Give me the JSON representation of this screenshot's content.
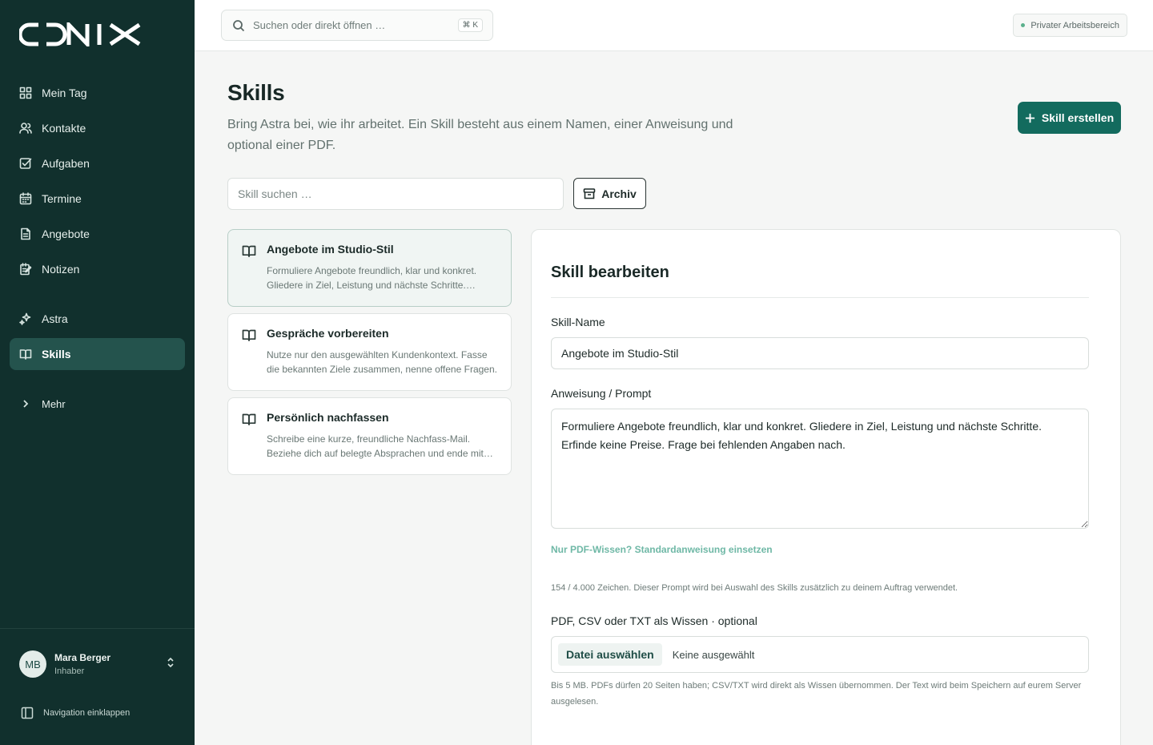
{
  "brand": {
    "logo": "CONIX"
  },
  "sidebar": {
    "items": [
      {
        "label": "Mein Tag",
        "icon": "dashboard-icon"
      },
      {
        "label": "Kontakte",
        "icon": "contacts-icon"
      },
      {
        "label": "Aufgaben",
        "icon": "tasks-icon"
      },
      {
        "label": "Termine",
        "icon": "calendar-icon"
      },
      {
        "label": "Angebote",
        "icon": "offers-icon"
      },
      {
        "label": "Notizen",
        "icon": "notes-icon"
      }
    ],
    "items2": [
      {
        "label": "Astra",
        "icon": "sparkles-icon"
      },
      {
        "label": "Skills",
        "icon": "book-icon",
        "active": true
      }
    ],
    "more": "Mehr",
    "user": {
      "initials": "MB",
      "name": "Mara Berger",
      "role": "Inhaber"
    },
    "collapse": "Navigation einklappen"
  },
  "topbar": {
    "search_placeholder": "Suchen oder direkt öffnen …",
    "shortcut": "⌘ K",
    "workspace": "Privater Arbeitsbereich"
  },
  "main": {
    "title": "Skills",
    "description": "Bring Astra bei, wie ihr arbeitet. Ein Skill besteht aus einem Namen, einer Anweisung und optional einer PDF.",
    "create_button": "Skill erstellen",
    "skill_search_placeholder": "Skill suchen …",
    "archive_button": "Archiv",
    "skills": [
      {
        "title": "Angebote im Studio-Stil",
        "desc": "Formuliere Angebote freundlich, klar und konkret. Gliedere in Ziel, Leistung und nächste Schritte. Erfinde keine Preise.",
        "selected": true
      },
      {
        "title": "Gespräche vorbereiten",
        "desc": "Nutze nur den ausgewählten Kundenkontext. Fasse die bekannten Ziele zusammen, nenne offene Fragen.",
        "selected": false
      },
      {
        "title": "Persönlich nachfassen",
        "desc": "Schreibe eine kurze, freundliche Nachfass-Mail. Beziehe dich auf belegte Absprachen und ende mit einer Frage.",
        "selected": false
      }
    ]
  },
  "editor": {
    "title": "Skill bearbeiten",
    "name_label": "Skill-Name",
    "name_value": "Angebote im Studio-Stil",
    "prompt_label": "Anweisung / Prompt",
    "prompt_value": "Formuliere Angebote freundlich, klar und konkret. Gliedere in Ziel, Leistung und nächste Schritte. Erfinde keine Preise. Frage bei fehlenden Angaben nach.",
    "default_link": "Nur PDF-Wissen? Standardanweisung einsetzen",
    "char_hint": "154 / 4.000 Zeichen. Dieser Prompt wird bei Auswahl des Skills zusätzlich zu deinem Auftrag verwendet.",
    "file_label": "PDF, CSV oder TXT als Wissen · optional",
    "file_button": "Datei auswählen",
    "file_status": "Keine ausgewählt",
    "file_hint": "Bis 5 MB. PDFs dürfen 20 Seiten haben; CSV/TXT wird direkt als Wissen übernommen. Der Text wird beim Speichern auf eurem Server ausgelesen."
  }
}
